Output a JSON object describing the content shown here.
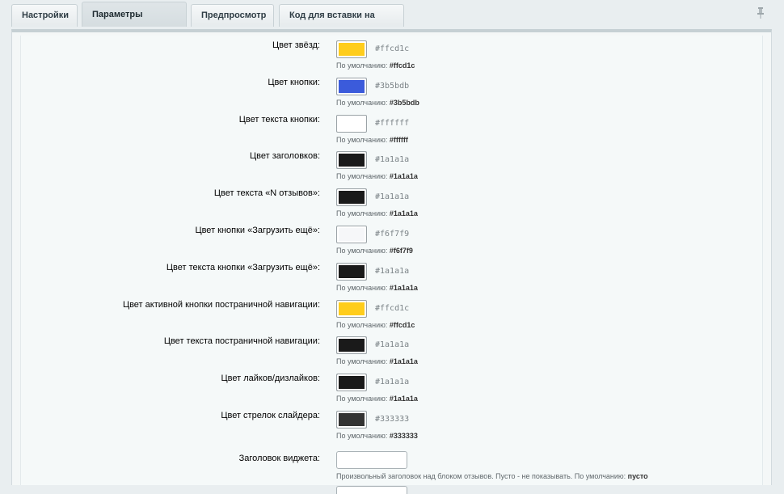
{
  "tabs": [
    {
      "label": "Настройки",
      "active": false
    },
    {
      "label": "Параметры вывода",
      "active": true
    },
    {
      "label": "Предпросмотр",
      "active": false
    },
    {
      "label": "Код для вставки на сайт",
      "active": false
    }
  ],
  "pin_icon": "pin-icon",
  "default_prefix": "По умолчанию:",
  "colors": [
    {
      "label": "Цвет звёзд:",
      "value": "#ffcd1c",
      "default": "#ffcd1c"
    },
    {
      "label": "Цвет кнопки:",
      "value": "#3b5bdb",
      "default": "#3b5bdb"
    },
    {
      "label": "Цвет текста кнопки:",
      "value": "#ffffff",
      "default": "#ffffff"
    },
    {
      "label": "Цвет заголовков:",
      "value": "#1a1a1a",
      "default": "#1a1a1a"
    },
    {
      "label": "Цвет текста «N отзывов»:",
      "value": "#1a1a1a",
      "default": "#1a1a1a"
    },
    {
      "label": "Цвет кнопки «Загрузить ещё»:",
      "value": "#f6f7f9",
      "default": "#f6f7f9"
    },
    {
      "label": "Цвет текста кнопки «Загрузить ещё»:",
      "value": "#1a1a1a",
      "default": "#1a1a1a"
    },
    {
      "label": "Цвет активной кнопки постраничной навигации:",
      "value": "#ffcd1c",
      "default": "#ffcd1c"
    },
    {
      "label": "Цвет текста постраничной навигации:",
      "value": "#1a1a1a",
      "default": "#1a1a1a"
    },
    {
      "label": "Цвет лайков/дизлайков:",
      "value": "#1a1a1a",
      "default": "#1a1a1a"
    },
    {
      "label": "Цвет стрелок слайдера:",
      "value": "#333333",
      "default": "#333333"
    }
  ],
  "widget_title": {
    "label": "Заголовок виджета:",
    "value": "",
    "hint_text": "Произвольный заголовок над блоком отзывов. Пусто - не показывать. По умолчанию:",
    "hint_default": "пусто"
  }
}
